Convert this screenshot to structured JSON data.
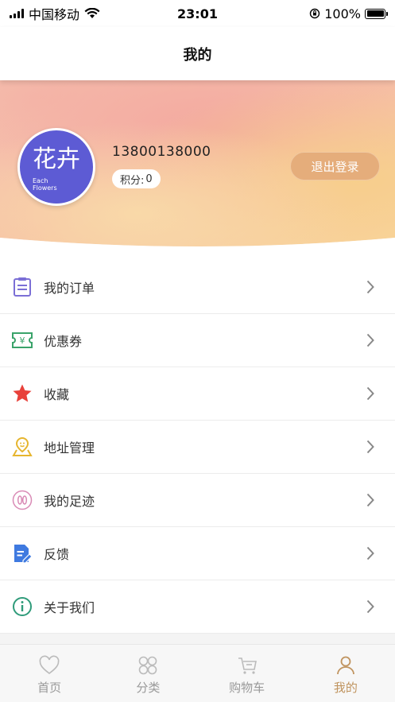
{
  "status_bar": {
    "carrier": "中国移动",
    "time": "23:01",
    "battery": "100%"
  },
  "nav": {
    "title": "我的"
  },
  "profile": {
    "avatar_text_main": "花卉",
    "avatar_text_sub1": "Each",
    "avatar_text_sub2": "Flowers",
    "phone": "13800138000",
    "points_label": "积分:",
    "points_value": "0",
    "logout_label": "退出登录"
  },
  "menu": {
    "items": [
      {
        "label": "我的订单",
        "icon": "clipboard-icon"
      },
      {
        "label": "优惠券",
        "icon": "coupon-icon"
      },
      {
        "label": "收藏",
        "icon": "star-icon"
      },
      {
        "label": "地址管理",
        "icon": "location-icon"
      },
      {
        "label": "我的足迹",
        "icon": "footprint-icon"
      },
      {
        "label": "反馈",
        "icon": "feedback-icon"
      },
      {
        "label": "关于我们",
        "icon": "info-icon"
      }
    ]
  },
  "tabs": [
    {
      "label": "首页",
      "icon": "heart-icon",
      "active": false
    },
    {
      "label": "分类",
      "icon": "category-icon",
      "active": false
    },
    {
      "label": "购物车",
      "icon": "cart-icon",
      "active": false
    },
    {
      "label": "我的",
      "icon": "person-icon",
      "active": true
    }
  ],
  "colors": {
    "accent": "#c0945f",
    "logout_button": "#e5ad7b",
    "avatar_bg": "#5d5bd4",
    "orders_icon": "#7b6fd6",
    "coupon_icon": "#3aa36a",
    "star_icon": "#e8413a",
    "location_icon": "#e6b52e",
    "footprint_icon": "#d98ab5",
    "feedback_icon": "#3f7ae0",
    "info_icon": "#2f9b7a"
  }
}
